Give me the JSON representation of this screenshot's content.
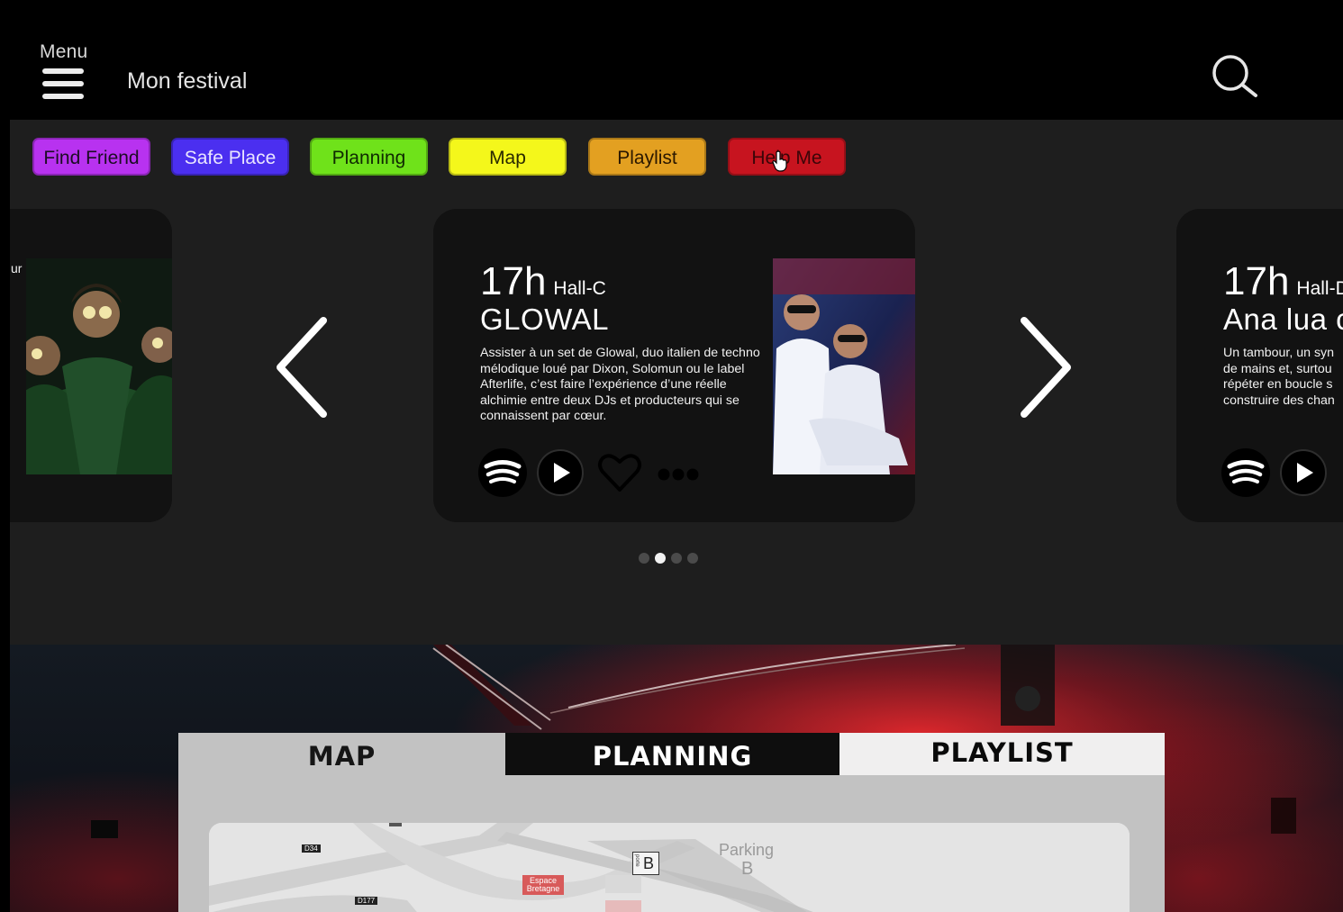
{
  "header": {
    "menu_label": "Menu",
    "app_title": "Mon festival",
    "search_icon": "search-icon",
    "menu_icon": "hamburger-icon"
  },
  "chips": [
    {
      "label": "Find Friend",
      "color": "#b832f0"
    },
    {
      "label": "Safe Place",
      "color": "#4b2ff0"
    },
    {
      "label": "Planning",
      "color": "#6fe21a"
    },
    {
      "label": "Map",
      "color": "#f4f71b"
    },
    {
      "label": "Playlist",
      "color": "#e3a021"
    },
    {
      "label": "Help Me",
      "color": "#c7141f"
    }
  ],
  "carousel": {
    "prev_icon": "chevron-left-icon",
    "next_icon": "chevron-right-icon",
    "left_card_fragment": "ur",
    "cards": [
      {
        "time": "17h",
        "hall": "Hall-C",
        "artist": "GLOWAL",
        "description": "Assister à un set de Glowal, duo italien de techno mélodique loué par Dixon, Solomun ou le label Afterlife, c’est faire l’expérience d’une réelle alchimie entre deux DJs et producteurs qui se connaissent par cœur."
      },
      {
        "time": "17h",
        "hall": "Hall-D",
        "artist": "Ana lua c",
        "description": "Un tambour, un syn de mains et, surtou répéter en boucle s construire des chan"
      }
    ],
    "actions": [
      "spotify-icon",
      "play-icon",
      "heart-icon",
      "more-icon"
    ],
    "pagination": {
      "count": 4,
      "active_index": 1
    }
  },
  "tabs": {
    "items": [
      "MAP",
      "PLANNING",
      "PLAYLIST"
    ],
    "colors": {
      "map_bg": "#c2c2c2",
      "planning_bg": "#0e0e0e",
      "playlist_bg": "#f0efef"
    }
  },
  "map": {
    "labels": {
      "d34": "D34",
      "d177": "D177",
      "espace": "Espace Bretagne",
      "parking": "Parking",
      "parking_letter": "B",
      "gate_letter": "B",
      "gate_side": "porte"
    }
  }
}
